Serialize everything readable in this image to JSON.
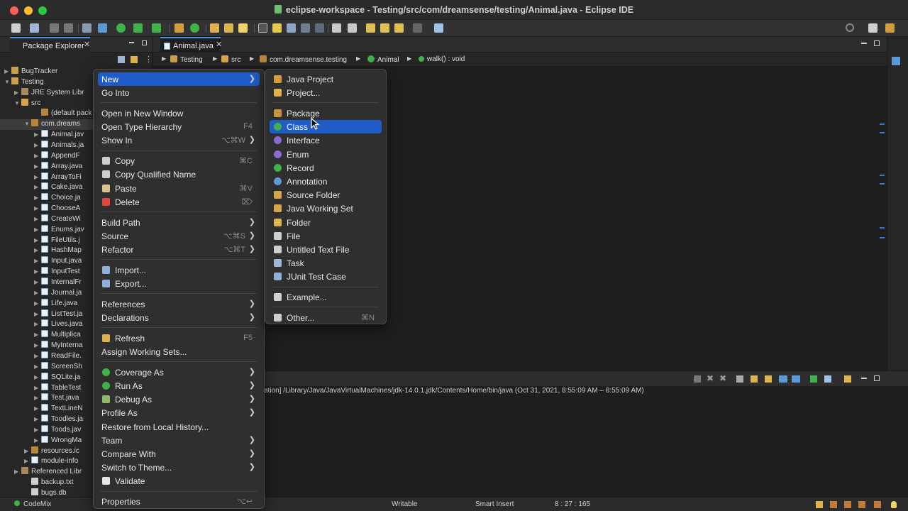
{
  "window": {
    "title": "eclipse-workspace - Testing/src/com/dreamsense/testing/Animal.java - Eclipse IDE"
  },
  "package_explorer": {
    "tab_label": "Package Explorer",
    "close_glyph": "✕",
    "tree": [
      {
        "label": "BugTracker",
        "icon": "project-icon",
        "twisty": "▶"
      },
      {
        "label": "Testing",
        "icon": "project-icon",
        "twisty": "▼"
      },
      {
        "label": "JRE System Libr",
        "icon": "library-icon",
        "twisty": "▶"
      },
      {
        "label": "src",
        "icon": "source-folder-icon",
        "twisty": "▼"
      },
      {
        "label": "(default pack",
        "icon": "package-icon",
        "twisty": ""
      },
      {
        "label": "com.dreams",
        "icon": "package-icon",
        "twisty": "▼"
      },
      {
        "label": "Animal.jav",
        "icon": "java-file-icon",
        "twisty": "▶"
      },
      {
        "label": "Animals.ja",
        "icon": "java-file-icon",
        "twisty": "▶"
      },
      {
        "label": "AppendF",
        "icon": "java-file-icon",
        "twisty": "▶"
      },
      {
        "label": "Array.java",
        "icon": "java-file-icon",
        "twisty": "▶"
      },
      {
        "label": "ArrayToFi",
        "icon": "java-file-icon",
        "twisty": "▶"
      },
      {
        "label": "Cake.java",
        "icon": "java-file-icon",
        "twisty": "▶"
      },
      {
        "label": "Choice.ja",
        "icon": "java-file-icon",
        "twisty": "▶"
      },
      {
        "label": "ChooseA",
        "icon": "java-file-icon",
        "twisty": "▶"
      },
      {
        "label": "CreateWi",
        "icon": "java-file-icon",
        "twisty": "▶"
      },
      {
        "label": "Enums.jav",
        "icon": "java-file-icon",
        "twisty": "▶"
      },
      {
        "label": "FileUtils.j",
        "icon": "java-file-icon",
        "twisty": "▶"
      },
      {
        "label": "HashMap",
        "icon": "java-file-icon",
        "twisty": "▶"
      },
      {
        "label": "Input.java",
        "icon": "java-file-icon",
        "twisty": "▶"
      },
      {
        "label": "InputTest",
        "icon": "java-file-icon",
        "twisty": "▶"
      },
      {
        "label": "InternalFr",
        "icon": "java-file-icon",
        "twisty": "▶"
      },
      {
        "label": "Journal.ja",
        "icon": "java-file-icon",
        "twisty": "▶"
      },
      {
        "label": "Life.java",
        "icon": "java-file-icon",
        "twisty": "▶"
      },
      {
        "label": "ListTest.ja",
        "icon": "java-file-icon",
        "twisty": "▶"
      },
      {
        "label": "Lives.java",
        "icon": "java-file-icon",
        "twisty": "▶"
      },
      {
        "label": "Multiplica",
        "icon": "java-file-icon",
        "twisty": "▶"
      },
      {
        "label": "MyInterna",
        "icon": "java-file-icon",
        "twisty": "▶"
      },
      {
        "label": "ReadFile.",
        "icon": "java-file-icon",
        "twisty": "▶"
      },
      {
        "label": "ScreenSh",
        "icon": "java-file-icon",
        "twisty": "▶"
      },
      {
        "label": "SQLite.ja",
        "icon": "java-file-icon",
        "twisty": "▶"
      },
      {
        "label": "TableTest",
        "icon": "java-file-icon",
        "twisty": "▶"
      },
      {
        "label": "Test.java",
        "icon": "java-file-icon",
        "twisty": "▶"
      },
      {
        "label": "TextLineN",
        "icon": "java-file-icon",
        "twisty": "▶"
      },
      {
        "label": "Toodles.ja",
        "icon": "java-file-icon",
        "twisty": "▶"
      },
      {
        "label": "Toods.jav",
        "icon": "java-file-icon",
        "twisty": "▶"
      },
      {
        "label": "WrongMa",
        "icon": "java-file-icon",
        "twisty": "▶"
      },
      {
        "label": "resources.ic",
        "icon": "package-icon",
        "twisty": "▶"
      },
      {
        "label": "module-info",
        "icon": "java-file-icon",
        "twisty": "▶"
      },
      {
        "label": "Referenced Libr",
        "icon": "library-icon",
        "twisty": "▶"
      },
      {
        "label": "backup.txt",
        "icon": "file-icon",
        "twisty": ""
      },
      {
        "label": "bugs.db",
        "icon": "file-icon",
        "twisty": ""
      }
    ]
  },
  "editor": {
    "tab_label": "Animal.java",
    "close_glyph": "✕",
    "breadcrumb": [
      "Testing",
      "src",
      "com.dreamsense.testing",
      "Animal",
      "walk() : void"
    ]
  },
  "console": {
    "line": "ation] /Library/Java/JavaVirtualMachines/jdk-14.0.1.jdk/Contents/Home/bin/java  (Oct 31, 2021, 8:55:09 AM – 8:55:09 AM)"
  },
  "status_bar": {
    "plugin": "CodeMix",
    "writable": "Writable",
    "insert_mode": "Smart Insert",
    "position": "8 : 27 : 165"
  },
  "context_menu": {
    "items": [
      {
        "label": "New",
        "submenu": true,
        "highlighted": true
      },
      {
        "label": "Go Into"
      },
      {
        "sep": true
      },
      {
        "label": "Open in New Window"
      },
      {
        "label": "Open Type Hierarchy",
        "shortcut": "F4"
      },
      {
        "label": "Show In",
        "shortcut": "⌥⌘W",
        "submenu": true
      },
      {
        "sep": true
      },
      {
        "label": "Copy",
        "shortcut": "⌘C",
        "icon": "copy-icon"
      },
      {
        "label": "Copy Qualified Name",
        "icon": "copy-qualified-icon"
      },
      {
        "label": "Paste",
        "shortcut": "⌘V",
        "icon": "paste-icon"
      },
      {
        "label": "Delete",
        "shortcut": "⌦",
        "icon": "delete-icon"
      },
      {
        "sep": true
      },
      {
        "label": "Build Path",
        "submenu": true
      },
      {
        "label": "Source",
        "shortcut": "⌥⌘S",
        "submenu": true
      },
      {
        "label": "Refactor",
        "shortcut": "⌥⌘T",
        "submenu": true
      },
      {
        "sep": true
      },
      {
        "label": "Import...",
        "icon": "import-icon"
      },
      {
        "label": "Export...",
        "icon": "export-icon"
      },
      {
        "sep": true
      },
      {
        "label": "References",
        "submenu": true
      },
      {
        "label": "Declarations",
        "submenu": true
      },
      {
        "sep": true
      },
      {
        "label": "Refresh",
        "shortcut": "F5",
        "icon": "refresh-icon"
      },
      {
        "label": "Assign Working Sets..."
      },
      {
        "sep": true
      },
      {
        "label": "Coverage As",
        "submenu": true,
        "icon": "coverage-icon"
      },
      {
        "label": "Run As",
        "submenu": true,
        "icon": "run-icon"
      },
      {
        "label": "Debug As",
        "submenu": true,
        "icon": "debug-icon"
      },
      {
        "label": "Profile As",
        "submenu": true
      },
      {
        "label": "Restore from Local History..."
      },
      {
        "label": "Team",
        "submenu": true
      },
      {
        "label": "Compare With",
        "submenu": true
      },
      {
        "label": "Switch to Theme...",
        "submenu": true
      },
      {
        "label": "Validate",
        "icon": "checkbox-checked-icon"
      },
      {
        "sep": true
      },
      {
        "label": "Properties",
        "shortcut": "⌥↩"
      }
    ]
  },
  "new_submenu": {
    "items": [
      {
        "label": "Java Project",
        "icon": "java-project-icon"
      },
      {
        "label": "Project...",
        "icon": "project-icon"
      },
      {
        "sep": true
      },
      {
        "label": "Package",
        "icon": "package-icon"
      },
      {
        "label": "Class",
        "icon": "class-icon",
        "highlighted": true
      },
      {
        "label": "Interface",
        "icon": "interface-icon"
      },
      {
        "label": "Enum",
        "icon": "enum-icon"
      },
      {
        "label": "Record",
        "icon": "record-icon"
      },
      {
        "label": "Annotation",
        "icon": "annotation-icon"
      },
      {
        "label": "Source Folder",
        "icon": "source-folder-icon"
      },
      {
        "label": "Java Working Set",
        "icon": "working-set-icon"
      },
      {
        "label": "Folder",
        "icon": "folder-icon"
      },
      {
        "label": "File",
        "icon": "file-icon"
      },
      {
        "label": "Untitled Text File",
        "icon": "text-file-icon"
      },
      {
        "label": "Task",
        "icon": "task-icon"
      },
      {
        "label": "JUnit Test Case",
        "icon": "junit-icon"
      },
      {
        "sep": true
      },
      {
        "label": "Example...",
        "icon": "example-icon"
      },
      {
        "sep": true
      },
      {
        "label": "Other...",
        "shortcut": "⌘N",
        "icon": "other-icon"
      }
    ]
  },
  "colors": {
    "accent": "#1f5cc5",
    "background": "#1e1e1e",
    "menu": "#2f2f2f",
    "delete": "#e0463a",
    "run": "#3fb24a"
  }
}
